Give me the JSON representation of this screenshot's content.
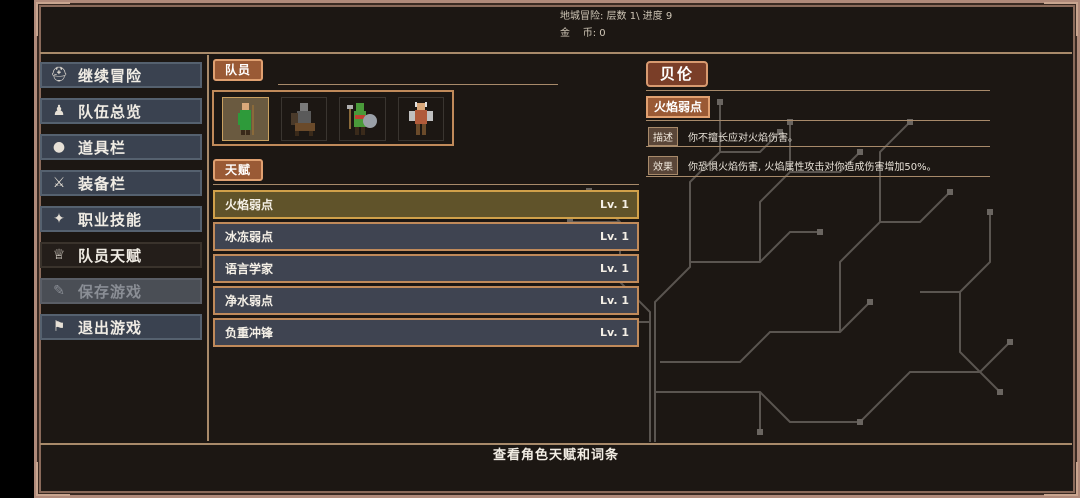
{
  "header": {
    "location_label": "地城冒险: 层数 1\\ 进度 9",
    "gold_label": "金    币: 0"
  },
  "sidebar": {
    "items": [
      {
        "label": "继续冒险",
        "icon": "helmet-icon"
      },
      {
        "label": "队伍总览",
        "icon": "party-icon"
      },
      {
        "label": "道具栏",
        "icon": "bag-icon"
      },
      {
        "label": "装备栏",
        "icon": "sword-shield-icon"
      },
      {
        "label": "职业技能",
        "icon": "wings-icon"
      },
      {
        "label": "队员天赋",
        "icon": "laurel-icon"
      },
      {
        "label": "保存游戏",
        "icon": "scroll-icon"
      },
      {
        "label": "退出游戏",
        "icon": "flag-icon"
      }
    ]
  },
  "party": {
    "tag": "队员",
    "members": [
      "mage-character",
      "knight-character",
      "orc-character",
      "warrior-character"
    ]
  },
  "talents": {
    "tag": "天赋",
    "items": [
      {
        "name": "火焰弱点",
        "level": "Lv. 1"
      },
      {
        "name": "冰冻弱点",
        "level": "Lv. 1"
      },
      {
        "name": "语言学家",
        "level": "Lv. 1"
      },
      {
        "name": "净水弱点",
        "level": "Lv. 1"
      },
      {
        "name": "负重冲锋",
        "level": "Lv. 1"
      }
    ]
  },
  "detail": {
    "character_name": "贝伦",
    "talent_name": "火焰弱点",
    "desc_label": "描述",
    "desc_text": "你不擅长应对火焰伤害。",
    "effect_label": "效果",
    "effect_text": "你恐惧火焰伤害, 火焰属性攻击对你造成伤害增加50%。"
  },
  "footer": {
    "hint": "查看角色天赋和词条"
  },
  "colors": {
    "frame": "#1c1713",
    "accent_tag": "#9a5a35",
    "button": "#3a4250",
    "selected_row": "#60532a"
  }
}
